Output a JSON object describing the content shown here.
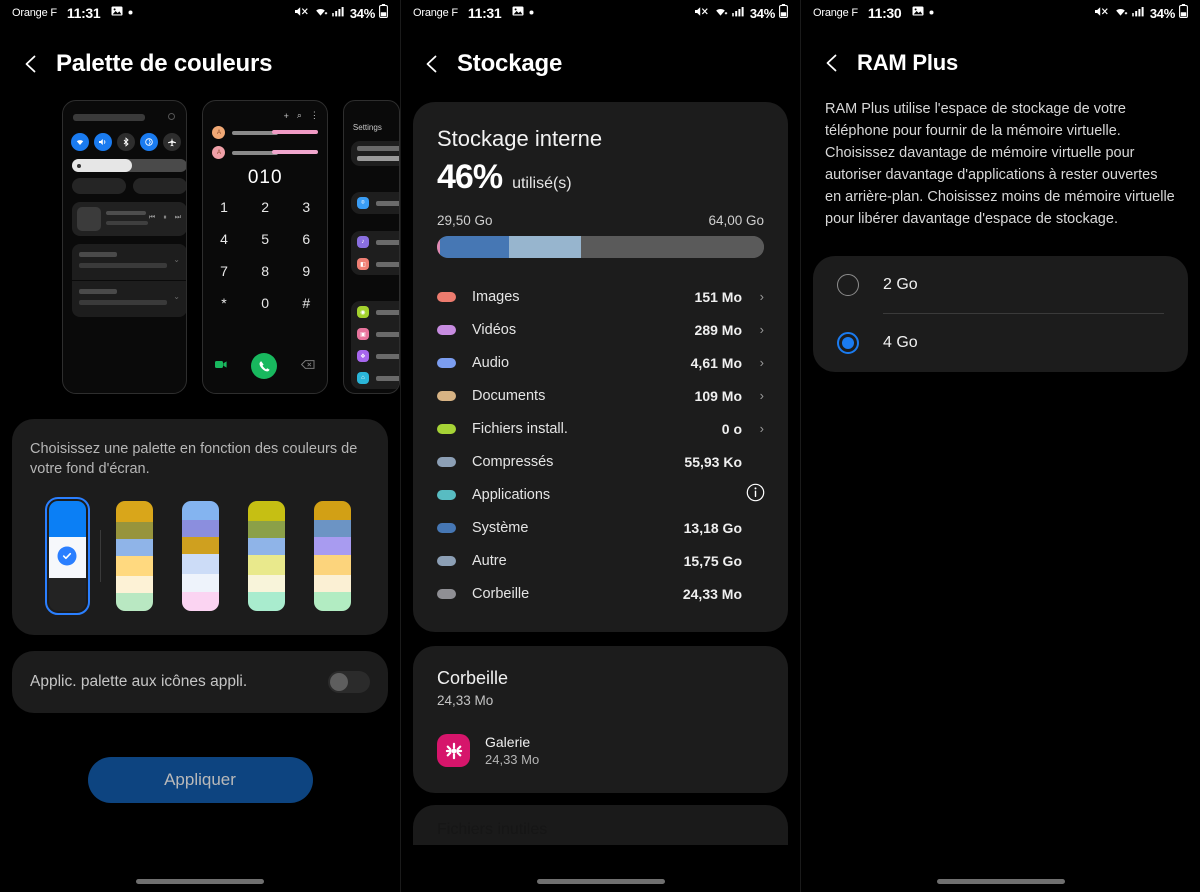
{
  "panels": {
    "left": {
      "status": {
        "carrier": "Orange F",
        "time": "11:31",
        "battery": "34%"
      },
      "title": "Palette de couleurs",
      "description": "Choisissez une palette en fonction des couleurs de votre fond d'écran.",
      "preview": {
        "dialer_number": "010",
        "keys": [
          "1",
          "2",
          "3",
          "4",
          "5",
          "6",
          "7",
          "8",
          "9",
          "*",
          "0",
          "#"
        ],
        "settings_label": "Settings"
      },
      "palettes": [
        {
          "name": "palette-basic",
          "selected": true,
          "bands": [
            "#0b7ff5",
            "#f6f8fb",
            "#f6f8fb",
            "#232323"
          ]
        },
        {
          "name": "palette-2",
          "selected": false,
          "bands": [
            "#d9a61a",
            "#97943c",
            "#8fb4e8",
            "#ffd97f",
            "#fdf2d6",
            "#b9e8c2"
          ]
        },
        {
          "name": "palette-3",
          "selected": false,
          "bands": [
            "#84b4f0",
            "#8b8ede",
            "#cfa01f",
            "#ccdcf7",
            "#eef3fb",
            "#fbd4f2"
          ]
        },
        {
          "name": "palette-4",
          "selected": false,
          "bands": [
            "#c6bf13",
            "#8ba048",
            "#8fb4e8",
            "#e9e98c",
            "#f8f4da",
            "#a9ecce"
          ]
        },
        {
          "name": "palette-5",
          "selected": false,
          "bands": [
            "#d2a015",
            "#6c94c4",
            "#a89bf0",
            "#fcd47c",
            "#fbf0d4",
            "#b2ecc2"
          ]
        }
      ],
      "toggle": {
        "label": "Applic. palette aux icônes appli.",
        "on": false
      },
      "apply_button": "Appliquer"
    },
    "middle": {
      "status": {
        "carrier": "Orange F",
        "time": "11:31",
        "battery": "34%"
      },
      "title": "Stockage",
      "storage": {
        "heading": "Stockage interne",
        "percent": "46%",
        "percent_suffix": "utilisé(s)",
        "used": "29,50 Go",
        "total": "64,00 Go",
        "bar_segments": [
          {
            "color": "#e08ab4",
            "pct": 1
          },
          {
            "color": "#4677b4",
            "pct": 21
          },
          {
            "color": "#97b5ce",
            "pct": 22
          },
          {
            "color": "#5a5a5a",
            "pct": 56
          }
        ]
      },
      "categories": [
        {
          "label": "Images",
          "value": "151 Mo",
          "color": "#ec7b6e",
          "chevron": true,
          "info": false
        },
        {
          "label": "Vidéos",
          "value": "289 Mo",
          "color": "#c78ce0",
          "chevron": true,
          "info": false
        },
        {
          "label": "Audio",
          "value": "4,61 Mo",
          "color": "#7b9df0",
          "chevron": true,
          "info": false
        },
        {
          "label": "Documents",
          "value": "109 Mo",
          "color": "#d7b384",
          "chevron": true,
          "info": false
        },
        {
          "label": "Fichiers install.",
          "value": "0 o",
          "color": "#a6d336",
          "chevron": true,
          "info": false
        },
        {
          "label": "Compressés",
          "value": "55,93 Ko",
          "color": "#8c9fb5",
          "chevron": false,
          "info": false
        },
        {
          "label": "Applications",
          "value": "",
          "color": "#58bcc2",
          "chevron": false,
          "info": true
        },
        {
          "label": "Système",
          "value": "13,18 Go",
          "color": "#4677b4",
          "chevron": false,
          "info": false
        },
        {
          "label": "Autre",
          "value": "15,75 Go",
          "color": "#8c9fb5",
          "chevron": false,
          "info": false
        },
        {
          "label": "Corbeille",
          "value": "24,33 Mo",
          "color": "#8f8f94",
          "chevron": false,
          "info": false
        }
      ],
      "trash": {
        "title": "Corbeille",
        "size": "24,33 Mo",
        "app_name": "Galerie",
        "app_size": "24,33 Mo"
      },
      "peek_label": "Fichiers inutiles"
    },
    "right": {
      "status": {
        "carrier": "Orange F",
        "time": "11:30",
        "battery": "34%"
      },
      "title": "RAM Plus",
      "description": "RAM Plus utilise l'espace de stockage de votre téléphone pour fournir de la mémoire virtuelle. Choisissez davantage de mémoire virtuelle pour autoriser davantage d'applications à rester ouvertes en arrière-plan. Choisissez moins de mémoire virtuelle pour libérer davantage d'espace de stockage.",
      "options": [
        {
          "label": "2 Go",
          "selected": false
        },
        {
          "label": "4 Go",
          "selected": true
        }
      ]
    }
  },
  "colors": {
    "accent": "#1a7bf0",
    "card": "#1c1c1c",
    "background": "#000000"
  }
}
